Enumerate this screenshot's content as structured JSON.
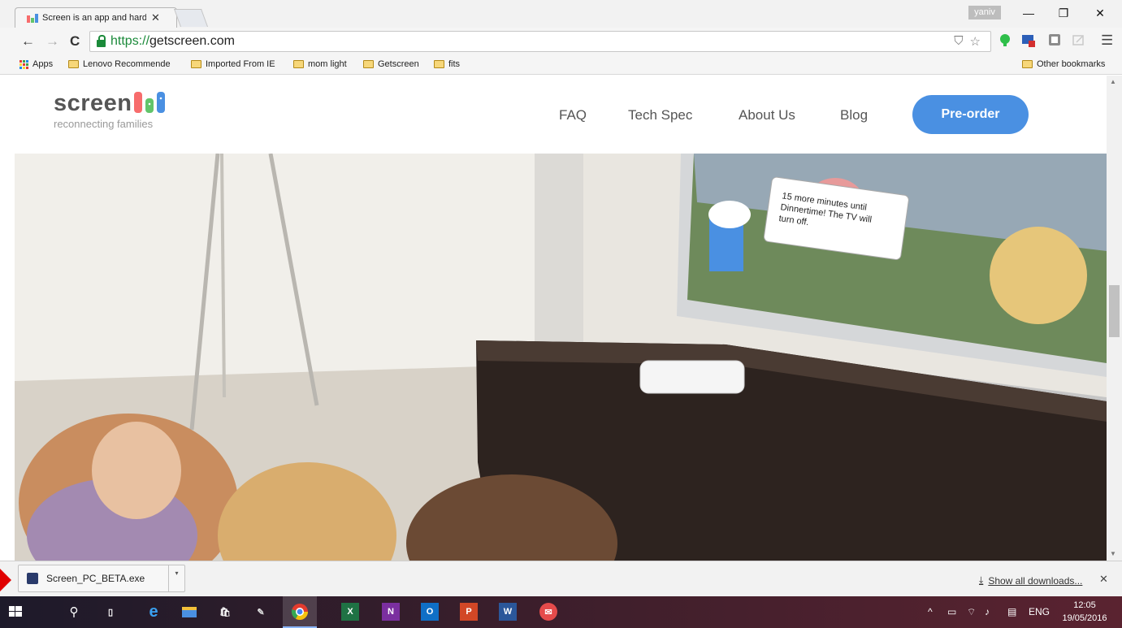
{
  "browser": {
    "tab_title": "Screen is an app and hard",
    "tab_close": "✕",
    "user_badge": "yaniv",
    "window_controls": {
      "minimize": "—",
      "restore": "❐",
      "close": "✕"
    },
    "url_scheme": "https://",
    "url_host": "getscreen.com",
    "bookmarks": [
      {
        "label": "Apps",
        "type": "apps"
      },
      {
        "label": "Lenovo Recommende",
        "type": "folder"
      },
      {
        "label": "Imported From IE",
        "type": "folder"
      },
      {
        "label": "mom light",
        "type": "folder"
      },
      {
        "label": "Getscreen",
        "type": "folder"
      },
      {
        "label": "fits",
        "type": "folder"
      }
    ],
    "other_bookmarks": "Other bookmarks"
  },
  "site": {
    "logo_word": "screen",
    "logo_tagline": "reconnecting families",
    "nav": [
      "FAQ",
      "Tech Spec",
      "About Us",
      "Blog"
    ],
    "cta": "Pre-order",
    "hero_speech_bubble": "15 more minutes until Dinnertime! The TV will turn off."
  },
  "downloads": {
    "file_name": "Screen_PC_BETA.exe",
    "show_all": "Show all downloads...",
    "close": "✕"
  },
  "taskbar": {
    "language": "ENG",
    "time": "12:05",
    "date": "19/05/2016",
    "app_labels": {
      "excel": "X",
      "onenote": "N",
      "outlook": "O",
      "powerpoint": "P",
      "word": "W"
    }
  },
  "colors": {
    "brand_blue": "#4a90e2",
    "logo_red": "#f76c6c",
    "logo_green": "#62c46a",
    "https_green": "#1b8a3a",
    "annotation_red": "#e00000"
  }
}
